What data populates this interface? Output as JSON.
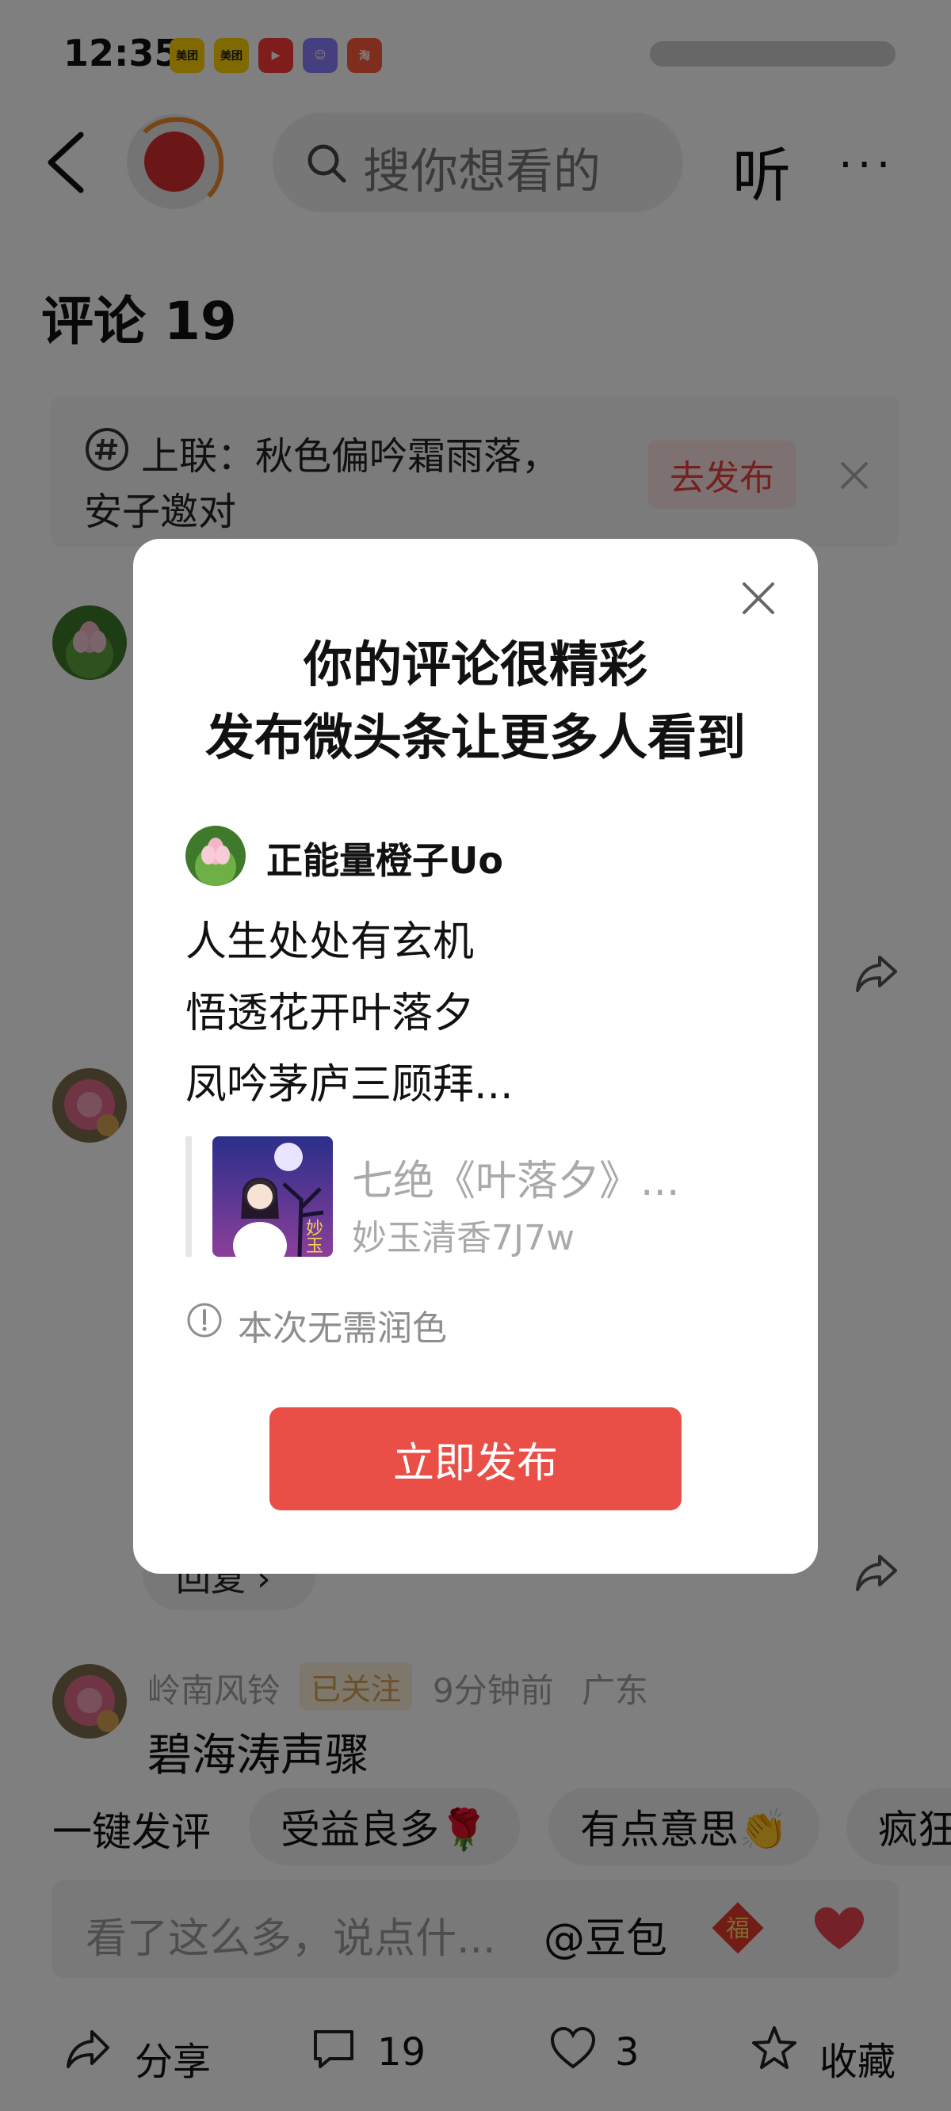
{
  "status_bar": {
    "time": "12:35",
    "apps": [
      {
        "label": "美团",
        "bg": "#ffd200",
        "fg": "#222"
      },
      {
        "label": "美团",
        "bg": "#ffd200",
        "fg": "#222"
      },
      {
        "label": "▶",
        "bg": "#ff3b3b",
        "fg": "#fff"
      },
      {
        "label": "☺",
        "bg": "#8a7dff",
        "fg": "#fff"
      },
      {
        "label": "淘",
        "bg": "#ff5c3c",
        "fg": "#fff"
      }
    ]
  },
  "header": {
    "search_placeholder": "搜你想看的",
    "listen_label": "听",
    "more_label": "···"
  },
  "comments": {
    "title": "评论 19"
  },
  "couplet": {
    "line1": "上联：秋色偏吟霜雨落，",
    "line2": "安子邀对",
    "publish_label": "去发布"
  },
  "comment3": {
    "name": "岭南风铃",
    "followed": "已关注",
    "time": "9分钟前",
    "region": "广东",
    "text": "碧海涛声骤",
    "reply_label": "回复 ›"
  },
  "quick_comment": {
    "label": "一键发评",
    "chips": [
      "受益良多🌹",
      "有点意思👏",
      "疯狂"
    ]
  },
  "input": {
    "placeholder": "看了这么多，说点什...",
    "doubao": "@豆包"
  },
  "bottom_bar": {
    "share": "分享",
    "comments": "19",
    "likes": "3",
    "favorite": "收藏"
  },
  "modal": {
    "title_line1": "你的评论很精彩",
    "title_line2": "发布微头条让更多人看到",
    "user": "正能量橙子Uo",
    "poem": [
      "人生处处有玄机",
      "悟透花开叶落夕",
      "凤吟茅庐三顾拜..."
    ],
    "quote_title": "七绝《叶落夕》...",
    "quote_author": "妙玉清香7J7w",
    "thumb_caption": "妙玉",
    "info": "本次无需润色",
    "publish_button": "立即发布"
  },
  "colors": {
    "accent": "#ea4f47",
    "followed_bg": "#fcefd8",
    "followed_fg": "#d7a254"
  }
}
